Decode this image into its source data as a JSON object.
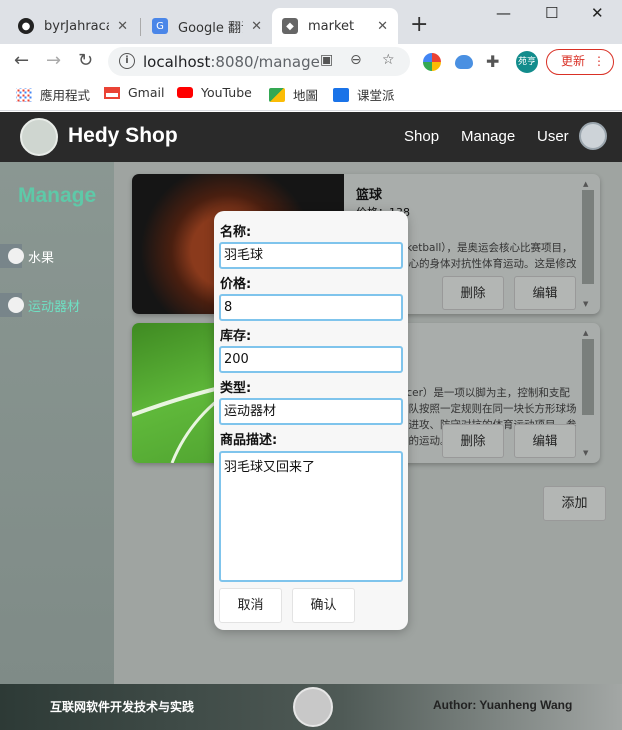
{
  "browser": {
    "tabs": [
      {
        "title": "byrJahracal",
        "icon": "github-icon"
      },
      {
        "title": "Google 翻译",
        "icon": "google-translate-icon"
      },
      {
        "title": "market",
        "icon": "cat-icon",
        "active": true
      }
    ],
    "new_tab": "+",
    "window_controls": {
      "minimize": "—",
      "maximize": "☐",
      "close": "✕"
    },
    "url_host": "localhost",
    "url_rest": ":8080/manage",
    "profile_label": "苑亨",
    "update_label": "更新",
    "bookmarks": [
      "應用程式",
      "Gmail",
      "YouTube",
      "地圖",
      "课堂派"
    ]
  },
  "app": {
    "brand": "Hedy Shop",
    "nav": [
      "Shop",
      "Manage",
      "User"
    ],
    "sidebar": {
      "title": "Manage",
      "items": [
        {
          "label": "水果",
          "icon": "apple-icon"
        },
        {
          "label": "运动器材",
          "icon": "basketball-icon",
          "active": true
        }
      ]
    },
    "products": [
      {
        "name": "篮球",
        "price": "价格：138",
        "description": "篮球（basketball），是奥运会核心比赛项目，是以手为中心的身体对抗性体育运动。这是修改后的描述。"
      },
      {
        "name": "",
        "price": "",
        "description": "足球（Soccer）是一项以脚为主，控制和支配球，两支球队按照一定规则在同一块长方形球场上互相进行进攻、防守对抗的体育运动项目。参与人数最多的运动。"
      }
    ],
    "delete_label": "删除",
    "edit_label": "编辑",
    "add_label": "添加",
    "footer": {
      "left": "互联网软件开发技术与实践",
      "right": "Author: Yuanheng Wang"
    }
  },
  "modal": {
    "name_label": "名称:",
    "name_value": "羽毛球",
    "price_label": "价格:",
    "price_value": "8",
    "stock_label": "库存:",
    "stock_value": "200",
    "type_label": "类型:",
    "type_value": "运动器材",
    "desc_label": "商品描述:",
    "desc_value": "羽毛球又回来了",
    "cancel_label": "取消",
    "confirm_label": "确认"
  },
  "colors": {
    "header_bg": "#2a2a2a",
    "sidebar_title": "#5ec9a8",
    "input_border": "#7fc4ec",
    "update_red": "#d93025"
  }
}
